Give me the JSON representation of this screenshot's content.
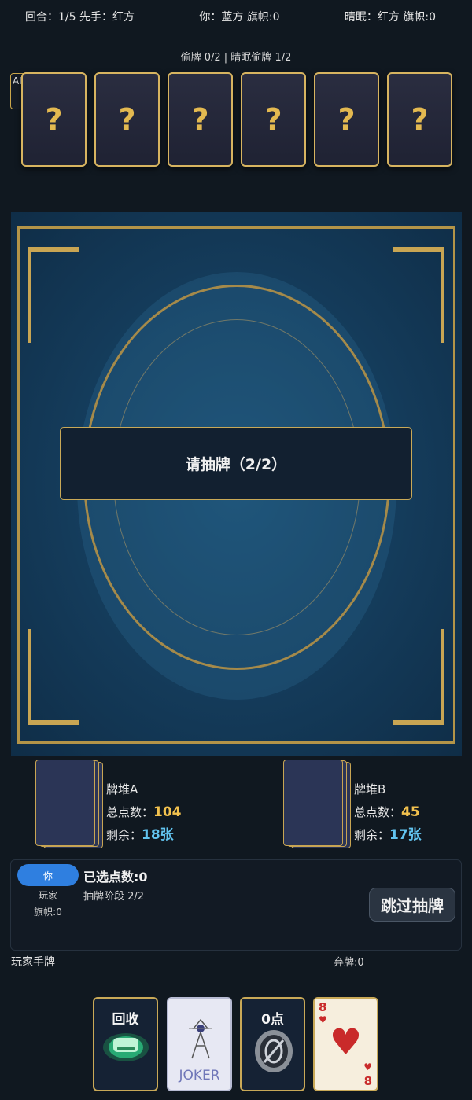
{
  "topbar": {
    "round": "回合：1/5  先手：红方",
    "you": "你：蓝方 旗帜:0",
    "opponent": "晴眠：红方 旗帜:0"
  },
  "steal_status": "偷牌 0/2 | 晴眠偷牌 1/2",
  "ai_tag": "AI",
  "opponent_cards": [
    "?",
    "?",
    "?",
    "?",
    "?",
    "?"
  ],
  "board": {
    "prompt": "请抽牌（2/2）"
  },
  "piles": [
    {
      "name": "牌堆A",
      "total_label": "总点数：",
      "total": "104",
      "remain_label": "剩余：",
      "remain": "18张"
    },
    {
      "name": "牌堆B",
      "total_label": "总点数：",
      "total": "45",
      "remain_label": "剩余：",
      "remain": "17张"
    }
  ],
  "player": {
    "badge": "你",
    "name": "玩家",
    "flags": "旗帜:0",
    "selected_points": "已选点数:0",
    "phase": "抽牌阶段 2/2",
    "skip_label": "跳过抽牌"
  },
  "hand": {
    "title": "玩家手牌",
    "discard": "弃牌:0",
    "cards": [
      {
        "label": "回收",
        "icon": "recycle-icon"
      },
      {
        "label": "JOKER",
        "icon": "joker-icon"
      },
      {
        "label": "0点",
        "icon": "zero-coin-icon"
      },
      {
        "rank": "8",
        "suit": "♥"
      }
    ]
  },
  "colors": {
    "accent_gold": "#c9a957",
    "player_blue": "#2f7fe0",
    "total_yellow": "#f2c14e",
    "remain_cyan": "#62c4f0",
    "heart_red": "#c92a2a"
  }
}
